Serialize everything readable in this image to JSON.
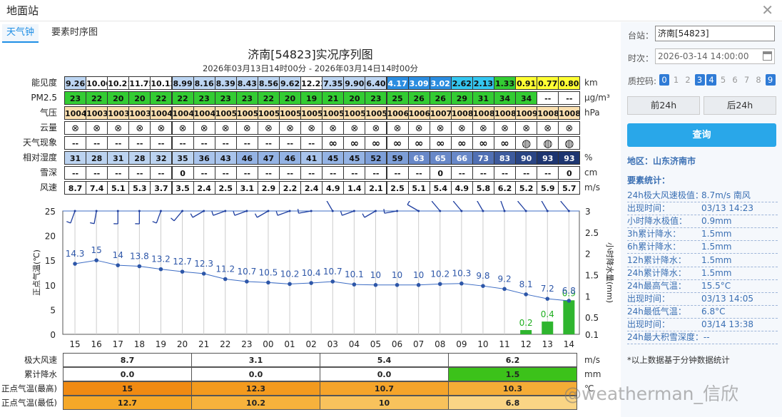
{
  "window": {
    "title": "地面站"
  },
  "tabs": [
    "天气钟",
    "要素时序图"
  ],
  "chart": {
    "title": "济南[54823]实况序列图",
    "subtitle": "2026年03月13日14时00分 - 2026年03月14日14时00分"
  },
  "rows": [
    {
      "label": "能见度",
      "unit": "km",
      "values": [
        "9.26",
        "10.06",
        "10.21",
        "11.75",
        "10.13",
        "8.99",
        "8.16",
        "8.39",
        "8.43",
        "8.56",
        "9.62",
        "12.23",
        "7.35",
        "9.90",
        "6.40",
        "4.17",
        "3.09",
        "3.02",
        "2.62",
        "2.13",
        "1.33",
        "0.91",
        "0.77",
        "0.80"
      ]
    },
    {
      "label": "PM2.5",
      "unit": "μg/m³",
      "values": [
        "23",
        "22",
        "20",
        "20",
        "22",
        "22",
        "23",
        "23",
        "23",
        "22",
        "20",
        "19",
        "21",
        "20",
        "23",
        "25",
        "26",
        "26",
        "29",
        "31",
        "34",
        "34",
        "--",
        "--"
      ]
    },
    {
      "label": "气压",
      "unit": "hPa",
      "values": [
        "1004",
        "1003",
        "1003",
        "1003",
        "1004",
        "1004",
        "1004",
        "1005",
        "1005",
        "1005",
        "1005",
        "1005",
        "1005",
        "1005",
        "1005",
        "1006",
        "1006",
        "1007",
        "1008",
        "1008",
        "1008",
        "1009",
        "1008",
        "1008"
      ]
    },
    {
      "label": "云量",
      "unit": "",
      "values": [
        "⊗",
        "⊗",
        "⊗",
        "⊗",
        "⊗",
        "⊗",
        "⊗",
        "⊗",
        "⊗",
        "⊗",
        "⊗",
        "⊗",
        "⊗",
        "⊗",
        "⊗",
        "⊗",
        "⊗",
        "⊗",
        "⊗",
        "⊗",
        "⊗",
        "⊗",
        "⊗",
        "⊗"
      ]
    },
    {
      "label": "天气现象",
      "unit": "",
      "values": [
        "--",
        "--",
        "--",
        "--",
        "--",
        "--",
        "--",
        "--",
        "--",
        "--",
        "--",
        "--",
        "∞",
        "∞",
        "∞",
        "∞",
        "∞",
        "∞",
        "∞",
        "∞",
        "∞",
        "◍",
        "◍",
        "◍"
      ]
    },
    {
      "label": "相对湿度",
      "unit": "%",
      "values": [
        "31",
        "28",
        "31",
        "28",
        "32",
        "35",
        "36",
        "43",
        "46",
        "47",
        "46",
        "41",
        "45",
        "45",
        "52",
        "59",
        "63",
        "65",
        "66",
        "73",
        "83",
        "90",
        "93",
        "93"
      ]
    },
    {
      "label": "雪深",
      "unit": "cm",
      "values": [
        "--",
        "--",
        "--",
        "--",
        "--",
        "0",
        "--",
        "--",
        "--",
        "--",
        "--",
        "--",
        "--",
        "--",
        "--",
        "--",
        "--",
        "0",
        "--",
        "--",
        "--",
        "--",
        "--",
        "0"
      ]
    },
    {
      "label": "风速",
      "unit": "m/s",
      "values": [
        "8.7",
        "7.4",
        "5.1",
        "5.3",
        "3.7",
        "3.5",
        "2.4",
        "2.5",
        "3.1",
        "2.9",
        "2.2",
        "2.4",
        "4.9",
        "1.4",
        "2.1",
        "2.5",
        "5.1",
        "5.4",
        "4.9",
        "5.8",
        "6.2",
        "5.2",
        "5.9",
        "5.7"
      ]
    }
  ],
  "chart_data": {
    "type": "line",
    "x": [
      "15",
      "16",
      "17",
      "18",
      "19",
      "20",
      "21",
      "22",
      "23",
      "00",
      "01",
      "02",
      "03",
      "04",
      "05",
      "06",
      "07",
      "08",
      "09",
      "10",
      "11",
      "12",
      "13",
      "14"
    ],
    "temperature": [
      14.3,
      15,
      14,
      13.8,
      13.2,
      12.7,
      12.3,
      11.2,
      10.7,
      10.5,
      10.2,
      10.4,
      10.7,
      10.1,
      10,
      10,
      10,
      10.2,
      10.3,
      9.8,
      9.2,
      8.1,
      7.2,
      6.8
    ],
    "precipitation": [
      0,
      0,
      0,
      0,
      0,
      0,
      0,
      0,
      0,
      0,
      0,
      0,
      0,
      0,
      0,
      0,
      0,
      0,
      0,
      0,
      0,
      0.2,
      0.4,
      0.9
    ],
    "precip_labels": [
      "",
      "",
      "",
      "",
      "",
      "",
      "",
      "",
      "",
      "",
      "",
      "",
      "",
      "",
      "",
      "",
      "",
      "",
      "",
      "",
      "",
      "0.2",
      "0.4",
      "0.9"
    ],
    "ylabel": "正点气温(℃)",
    "y2label": "小时降水量(mm)",
    "ylim": [
      0,
      25
    ],
    "y2lim": [
      0.1,
      3
    ],
    "yticks": [
      "0",
      "5",
      "10",
      "15",
      "20",
      "25"
    ],
    "y2ticks": [
      "0.1",
      "0.5",
      "1",
      "1.5",
      "2",
      "2.5",
      "3"
    ],
    "grid": true,
    "line_color": "#3c6cc4",
    "bar_color": "#2fb52f"
  },
  "bottom": {
    "rows": [
      {
        "label": "极大风速",
        "unit": "m/s",
        "values": [
          "8.7",
          "3.1",
          "5.4",
          "6.2"
        ]
      },
      {
        "label": "累计降水",
        "unit": "mm",
        "values": [
          "0.0",
          "0.0",
          "0.0",
          "1.5"
        ]
      },
      {
        "label": "正点气温(最高)",
        "unit": "℃",
        "values": [
          "15",
          "12.3",
          "10.7",
          "10.3"
        ]
      },
      {
        "label": "正点气温(最低)",
        "unit": "",
        "values": [
          "12.7",
          "10.2",
          "10",
          "6.8"
        ]
      }
    ]
  },
  "panel": {
    "station_label": "台站：",
    "station_value": "济南[54823]",
    "time_label": "时次：",
    "time_value": "2026-03-14 14:00:00",
    "qc_label": "质控码:",
    "qc_codes": [
      "0",
      "1",
      "2",
      "3",
      "4",
      "5",
      "6",
      "7",
      "8",
      "9"
    ],
    "prev_btn": "前24h",
    "next_btn": "后24h",
    "query_btn": "查询",
    "region": "地区：山东济南市",
    "stats_title": "要素统计：",
    "stats": [
      {
        "k": "24h极大风速极值：",
        "v": "8.7m/s 南风"
      },
      {
        "k": "出现时间：",
        "v": "03/13 14:23"
      },
      {
        "k": "小时降水极值：",
        "v": "0.9mm"
      },
      {
        "k": "3h累计降水：",
        "v": "1.5mm"
      },
      {
        "k": "6h累计降水：",
        "v": "1.5mm"
      },
      {
        "k": "12h累计降水：",
        "v": "1.5mm"
      },
      {
        "k": "24h累计降水：",
        "v": "1.5mm"
      },
      {
        "k": "24h最高气温：",
        "v": "15.5°C"
      },
      {
        "k": "出现时间：",
        "v": "03/13 14:05"
      },
      {
        "k": "24h最低气温：",
        "v": "6.8°C"
      },
      {
        "k": "出现时间：",
        "v": "03/14 13:38"
      },
      {
        "k": "24h最大积雪深度：--",
        "v": ""
      }
    ],
    "note": "*以上数据基于分钟数据统计"
  },
  "watermark": "@weatherman_信欣",
  "colors": {
    "vis": [
      "#bcd5f2",
      "#ffffff",
      "#ffffff",
      "#ffffff",
      "#ffffff",
      "#bcd5f2",
      "#bcd5f2",
      "#bcd5f2",
      "#bcd5f2",
      "#bcd5f2",
      "#bcd5f2",
      "#ffffff",
      "#bcd5f2",
      "#bcd5f2",
      "#bcd5f2",
      "#2b8de0",
      "#2b8de0",
      "#2b8de0",
      "#34c6f0",
      "#34c6f0",
      "#33cc33",
      "#ffff33",
      "#ffff33",
      "#ffff33"
    ],
    "humid_scale": [
      "#bcd3f0",
      "#a9c4ec",
      "#94b3e4",
      "#7e9fd8",
      "#6888c8",
      "#5170b4",
      "#3e5b9d",
      "#2a4584",
      "#1d3570"
    ],
    "pm": "#33cc33",
    "pressure": "#fbe0b0"
  }
}
